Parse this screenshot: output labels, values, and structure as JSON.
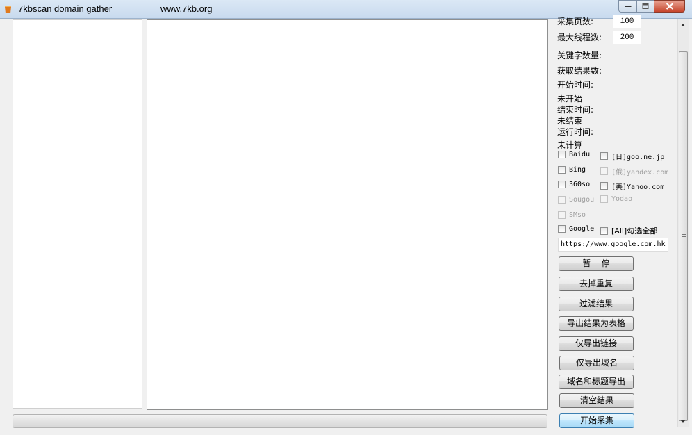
{
  "window": {
    "title": "7kbscan domain gather",
    "url": "www.7kb.org"
  },
  "settings": {
    "pages_label": "采集页数:",
    "pages_value": "100",
    "threads_label": "最大线程数:",
    "threads_value": "200"
  },
  "stats": {
    "keyword_count_label": "关键字数量:",
    "result_count_label": "获取结果数:",
    "start_time_label": "开始时间:",
    "start_time_value": "未开始",
    "end_time_label": "结束时间:",
    "end_time_value": "未结束",
    "run_time_label": "运行时间:",
    "run_time_value": "未计算"
  },
  "engines": [
    {
      "label": "Baidu",
      "checked": false,
      "enabled": true
    },
    {
      "label": "[日]goo.ne.jp",
      "checked": false,
      "enabled": true
    },
    {
      "label": "Bing",
      "checked": false,
      "enabled": true
    },
    {
      "label": "[俄]yandex.com",
      "checked": false,
      "enabled": false
    },
    {
      "label": "360so",
      "checked": false,
      "enabled": true
    },
    {
      "label": "[美]Yahoo.com",
      "checked": false,
      "enabled": true
    },
    {
      "label": "Sougou",
      "checked": false,
      "enabled": false
    },
    {
      "label": "Yodao",
      "checked": false,
      "enabled": false
    },
    {
      "label": "SMso",
      "checked": false,
      "enabled": false
    },
    {
      "label": "Google",
      "checked": false,
      "enabled": true
    },
    {
      "label": "[All]勾选全部",
      "checked": false,
      "enabled": true
    }
  ],
  "google_url": "https://www.google.com.hk",
  "buttons": {
    "pause": "暂    停",
    "dedupe": "去掉重复",
    "filter": "过滤结果",
    "export_table": "导出结果为表格",
    "export_links": "仅导出链接",
    "export_domains": "仅导出域名",
    "export_domain_title": "域名和标题导出",
    "clear": "清空结果",
    "start": "开始采集"
  },
  "progress": 0
}
